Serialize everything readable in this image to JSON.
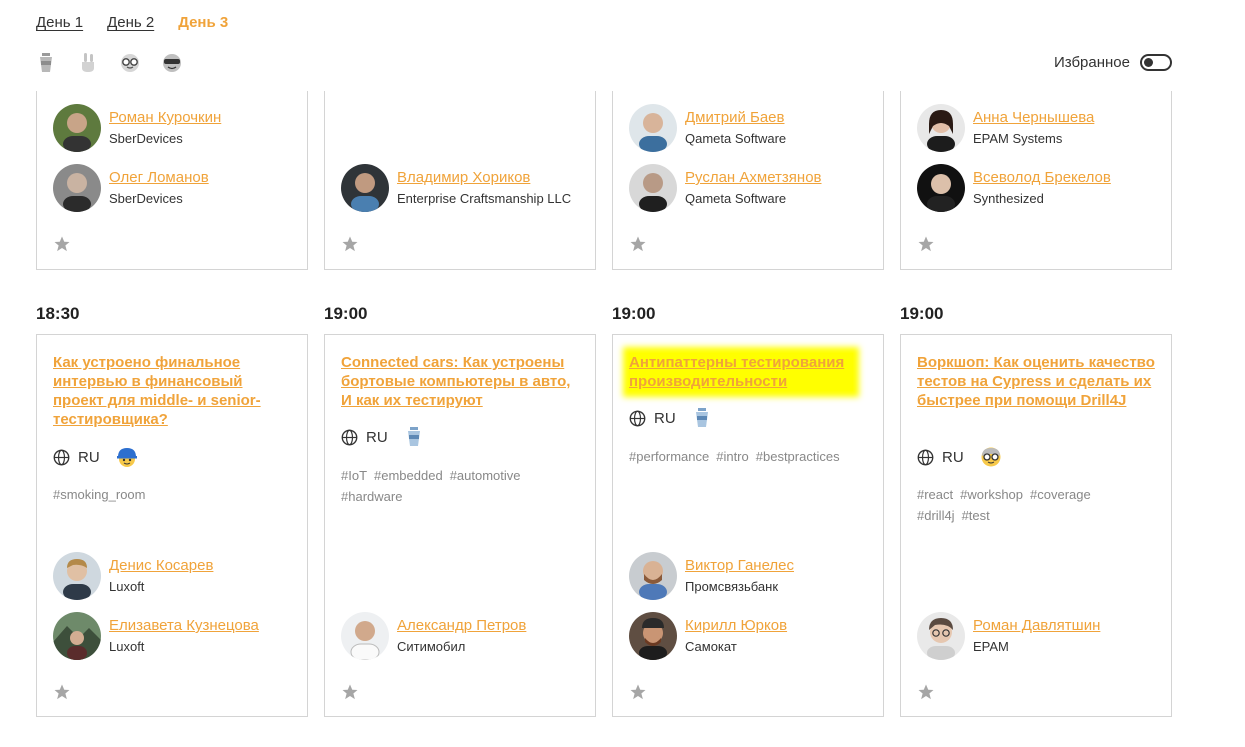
{
  "days": [
    "День 1",
    "День 2",
    "День 3"
  ],
  "favorites_label": "Избранное",
  "filter_icons": [
    "cup-icon",
    "rock-hand-icon",
    "nerd-face-icon",
    "cool-face-icon"
  ],
  "colors": {
    "accent": "#f0a33a",
    "highlight": "#ffff00",
    "border": "#d4d4d4"
  },
  "top_row": [
    {
      "speakers": [
        {
          "name": "Роман Курочкин",
          "company": "SberDevices"
        },
        {
          "name": "Олег Ломанов",
          "company": "SberDevices"
        }
      ]
    },
    {
      "speakers": [
        {
          "name": "Владимир Хориков",
          "company": "Enterprise Craftsmanship LLC"
        }
      ]
    },
    {
      "speakers": [
        {
          "name": "Дмитрий Баев",
          "company": "Qameta Software"
        },
        {
          "name": "Руслан Ахметзянов",
          "company": "Qameta Software"
        }
      ]
    },
    {
      "speakers": [
        {
          "name": "Анна Чернышева",
          "company": "EPAM Systems"
        },
        {
          "name": "Всеволод Брекелов",
          "company": "Synthesized"
        }
      ]
    }
  ],
  "talks": [
    {
      "time": "18:30",
      "title": "Как устроено финальное интервью в финансовый проект для middle- и senior-тестировщика?",
      "lang": "RU",
      "level_icon": "worker-face-icon",
      "tags": [
        "#smoking_room"
      ],
      "speakers": [
        {
          "name": "Денис Косарев",
          "company": "Luxoft"
        },
        {
          "name": "Елизавета Кузнецова",
          "company": "Luxoft"
        }
      ]
    },
    {
      "time": "19:00",
      "title": "Connected cars: Как устроены бортовые компьютеры в авто, И как их тестируют",
      "lang": "RU",
      "level_icon": "cup-icon",
      "tags": [
        "#IoT",
        "#embedded",
        "#automotive",
        "#hardware"
      ],
      "speakers": [
        {
          "name": "Александр Петров",
          "company": "Ситимобил"
        }
      ]
    },
    {
      "time": "19:00",
      "title": "Антипаттерны тестирования производительности",
      "lang": "RU",
      "level_icon": "cup-icon",
      "tags": [
        "#performance",
        "#intro",
        "#bestpractices"
      ],
      "speakers": [
        {
          "name": "Виктор Ганелес",
          "company": "Промсвязьбанк"
        },
        {
          "name": "Кирилл Юрков",
          "company": "Самокат"
        }
      ]
    },
    {
      "time": "19:00",
      "title": "Воркшоп: Как оценить качество тестов на Cypress и сделать их быстрее при помощи Drill4J",
      "lang": "RU",
      "level_icon": "nerd-face-icon",
      "tags": [
        "#react",
        "#workshop",
        "#coverage",
        "#drill4j",
        "#test"
      ],
      "speakers": [
        {
          "name": "Роман Давлятшин",
          "company": "EPAM"
        }
      ]
    }
  ]
}
